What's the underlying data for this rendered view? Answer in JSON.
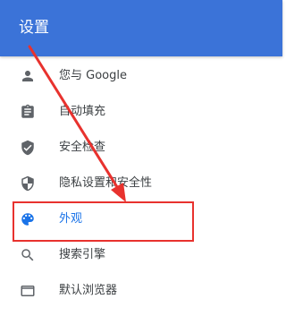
{
  "header": {
    "title": "设置"
  },
  "menu": {
    "items": [
      {
        "label": "您与 Google",
        "icon": "person-icon"
      },
      {
        "label": "自动填充",
        "icon": "clipboard-icon"
      },
      {
        "label": "安全检查",
        "icon": "shield-check-icon"
      },
      {
        "label": "隐私设置和安全性",
        "icon": "shield-half-icon"
      },
      {
        "label": "外观",
        "icon": "palette-icon",
        "active": true
      },
      {
        "label": "搜索引擎",
        "icon": "search-icon"
      },
      {
        "label": "默认浏览器",
        "icon": "browser-window-icon"
      }
    ]
  },
  "colors": {
    "header": "#3b73d8",
    "active_text": "#1a73e8",
    "text": "#3c4043",
    "icon": "#5f6368",
    "annotation": "#e8322e"
  }
}
